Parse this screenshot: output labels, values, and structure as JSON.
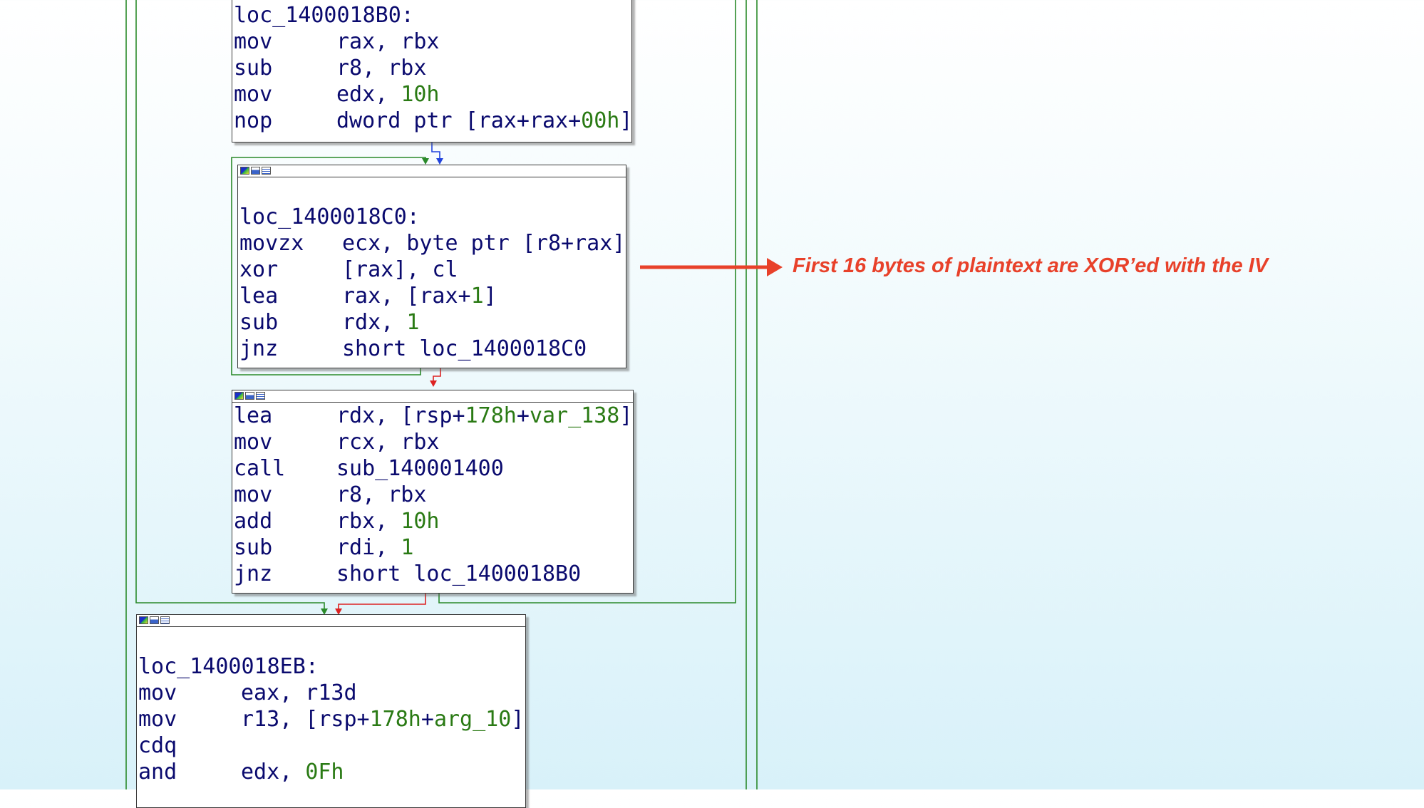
{
  "colors": {
    "background_top": "#ffffff",
    "background_bottom": "#d8f1f9",
    "edge_green": "#2a8a2a",
    "edge_red": "#dd2222",
    "edge_blue": "#2244dd",
    "instruction_text": "#0a0a6e",
    "number_text": "#2a7a14",
    "annotation": "#e8412a"
  },
  "icons": [
    "graph-color-icon",
    "graph-edit-icon",
    "graph-list-icon"
  ],
  "nodes": {
    "block_18b0": {
      "label": "loc_1400018B0:",
      "lines": [
        {
          "mnemonic": "mov",
          "op": "rax, rbx",
          "num": "",
          "tail": ""
        },
        {
          "mnemonic": "sub",
          "op": "r8, rbx",
          "num": "",
          "tail": ""
        },
        {
          "mnemonic": "mov",
          "op": "edx, ",
          "num": "10h",
          "tail": ""
        },
        {
          "mnemonic": "nop",
          "op": "dword ptr [rax+rax+",
          "num": "00h",
          "tail": "]"
        }
      ]
    },
    "block_18c0": {
      "label": "loc_1400018C0:",
      "lines": [
        {
          "mnemonic": "movzx",
          "op": "ecx, byte ptr [r8+rax]",
          "num": "",
          "tail": ""
        },
        {
          "mnemonic": "xor",
          "op": "[rax], cl",
          "num": "",
          "tail": ""
        },
        {
          "mnemonic": "lea",
          "op": "rax, [rax+",
          "num": "1",
          "tail": "]"
        },
        {
          "mnemonic": "sub",
          "op": "rdx, ",
          "num": "1",
          "tail": ""
        },
        {
          "mnemonic": "jnz",
          "op": "short loc_1400018C0",
          "num": "",
          "tail": ""
        }
      ]
    },
    "block_call": {
      "lines": [
        {
          "mnemonic": "lea",
          "op": "rdx, [rsp+",
          "num": "178h",
          "tail": "+",
          "num2": "var_138",
          "tail2": "]"
        },
        {
          "mnemonic": "mov",
          "op": "rcx, rbx",
          "num": "",
          "tail": ""
        },
        {
          "mnemonic": "call",
          "op": "sub_140001400",
          "num": "",
          "tail": ""
        },
        {
          "mnemonic": "mov",
          "op": "r8, rbx",
          "num": "",
          "tail": ""
        },
        {
          "mnemonic": "add",
          "op": "rbx, ",
          "num": "10h",
          "tail": ""
        },
        {
          "mnemonic": "sub",
          "op": "rdi, ",
          "num": "1",
          "tail": ""
        },
        {
          "mnemonic": "jnz",
          "op": "short loc_1400018B0",
          "num": "",
          "tail": ""
        }
      ]
    },
    "block_18eb": {
      "label": "loc_1400018EB:",
      "lines": [
        {
          "mnemonic": "mov",
          "op": "eax, r13d",
          "num": "",
          "tail": ""
        },
        {
          "mnemonic": "mov",
          "op": "r13, [rsp+",
          "num": "178h",
          "tail": "+",
          "num2": "arg_10",
          "tail2": "]"
        },
        {
          "mnemonic": "cdq",
          "op": "",
          "num": "",
          "tail": ""
        },
        {
          "mnemonic": "and",
          "op": "edx, ",
          "num": "0Fh",
          "tail": ""
        }
      ]
    }
  },
  "annotation": {
    "text": "First 16 bytes of plaintext are XOR’ed with the IV"
  }
}
